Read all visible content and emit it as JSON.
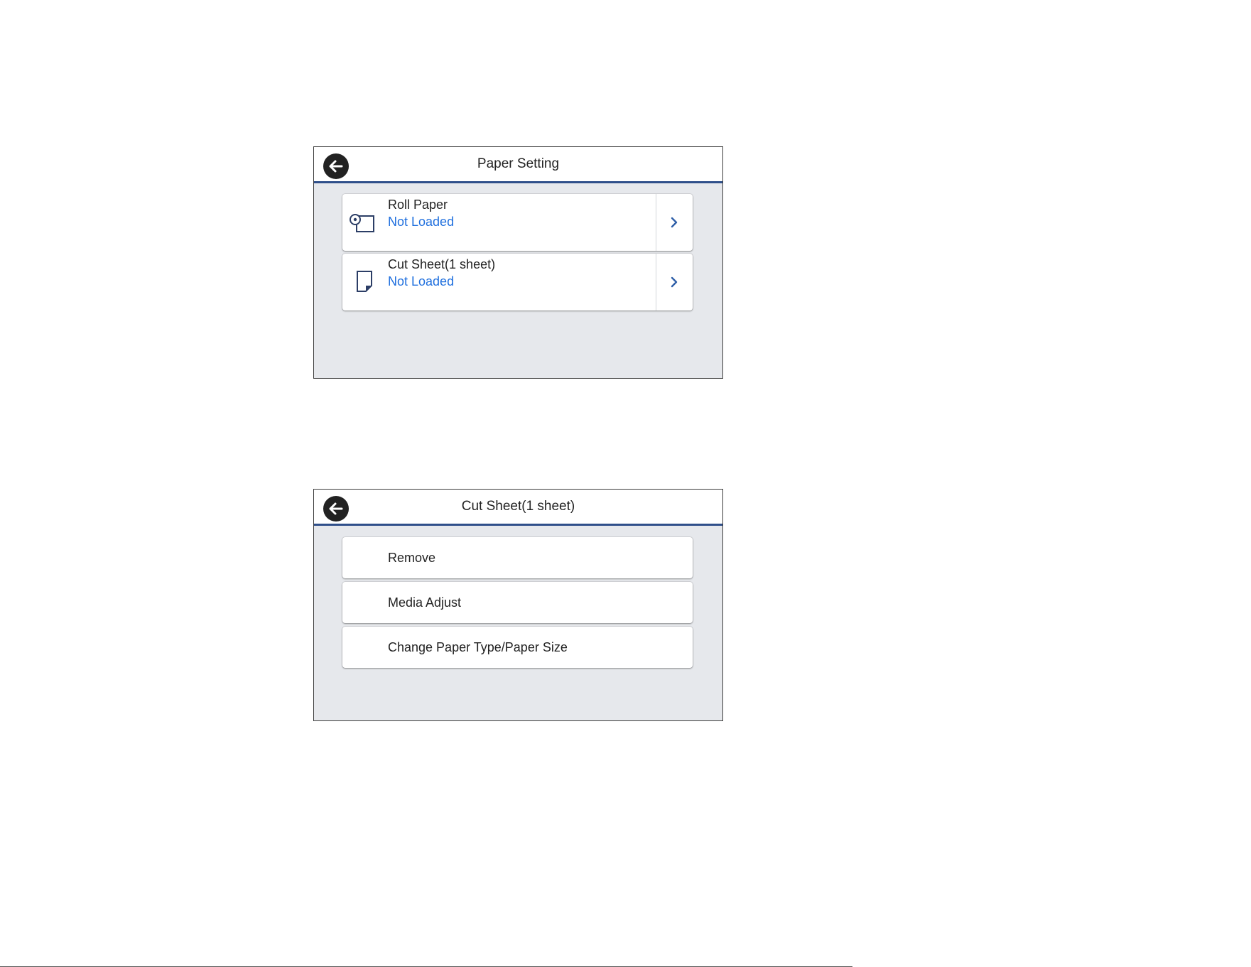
{
  "screen1": {
    "title": "Paper Setting",
    "items": [
      {
        "label": "Roll Paper",
        "status": "Not Loaded",
        "icon": "roll-paper-icon"
      },
      {
        "label": "Cut Sheet(1 sheet)",
        "status": "Not Loaded",
        "icon": "cut-sheet-icon"
      }
    ]
  },
  "screen2": {
    "title": "Cut Sheet(1 sheet)",
    "items": [
      {
        "label": "Remove"
      },
      {
        "label": "Media Adjust"
      },
      {
        "label": "Change Paper Type/Paper Size"
      }
    ]
  },
  "colors": {
    "header_rule": "#2f4f8a",
    "status_text": "#1f6fde",
    "panel_background": "#e6e8ec"
  }
}
